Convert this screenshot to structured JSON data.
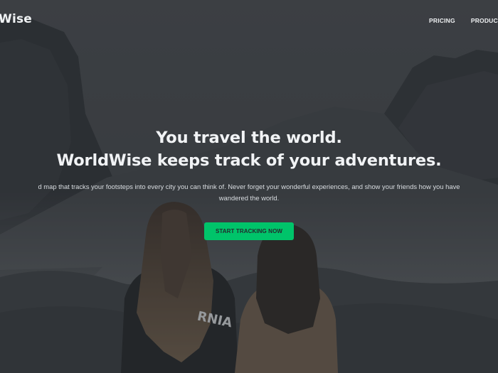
{
  "nav": {
    "logo_text": "Wise",
    "links": [
      {
        "label": "PRICING"
      },
      {
        "label": "PRODUCT"
      }
    ]
  },
  "hero": {
    "headline_line1": "You travel the world.",
    "headline_line2": "WorldWise keeps track of your adventures.",
    "subtext_line1": "d map that tracks your footsteps into every city you can think of. Never forget your wonderful experiences, and show your friends how you have",
    "subtext_line2": "wandered the world.",
    "cta_label": "START TRACKING NOW"
  },
  "colors": {
    "overlay": "#3a3e44",
    "cta_bg": "#00c46a",
    "text": "#f1f3f5"
  }
}
